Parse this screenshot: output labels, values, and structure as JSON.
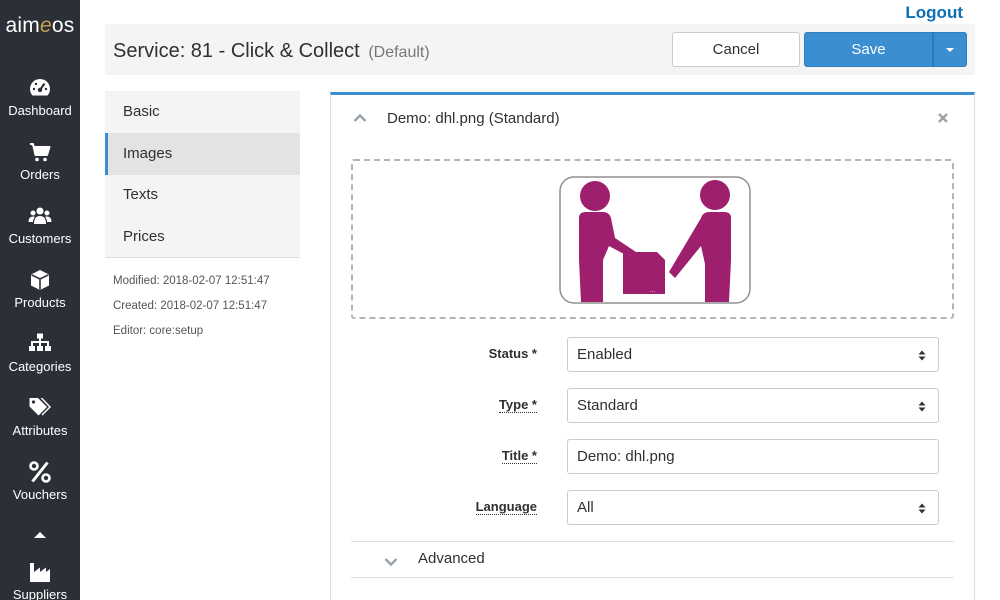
{
  "logo": {
    "pre": "aim",
    "accent": "e",
    "post": "os"
  },
  "nav": [
    {
      "label": "Dashboard",
      "icon": "dashboard-icon"
    },
    {
      "label": "Orders",
      "icon": "cart-icon"
    },
    {
      "label": "Customers",
      "icon": "users-icon"
    },
    {
      "label": "Products",
      "icon": "box-icon"
    },
    {
      "label": "Categories",
      "icon": "sitemap-icon"
    },
    {
      "label": "Attributes",
      "icon": "tags-icon"
    },
    {
      "label": "Vouchers",
      "icon": "percent-icon"
    },
    {
      "label": "Suppliers",
      "icon": "industry-icon"
    }
  ],
  "logout": "Logout",
  "header": {
    "title": "Service: 81 - Click & Collect",
    "subtitle": "(Default)",
    "cancel": "Cancel",
    "save": "Save"
  },
  "tabs": [
    {
      "label": "Basic",
      "active": false
    },
    {
      "label": "Images",
      "active": true
    },
    {
      "label": "Texts",
      "active": false
    },
    {
      "label": "Prices",
      "active": false
    }
  ],
  "meta": {
    "modified": "Modified: 2018-02-07 12:51:47",
    "created": "Created: 2018-02-07 12:51:47",
    "editor": "Editor: core:setup"
  },
  "card": {
    "title": "Demo: dhl.png (Standard)",
    "form": {
      "status_label": "Status *",
      "status_value": "Enabled",
      "type_label": "Type *",
      "type_value": "Standard",
      "title_label": "Title *",
      "title_value": "Demo: dhl.png",
      "language_label": "Language",
      "language_value": "All"
    },
    "advanced": "Advanced"
  },
  "colors": {
    "sidebar": "#2b3038",
    "accent": "#3b8fd1",
    "link": "#0b6fb8",
    "image": "#9e1f6e"
  }
}
